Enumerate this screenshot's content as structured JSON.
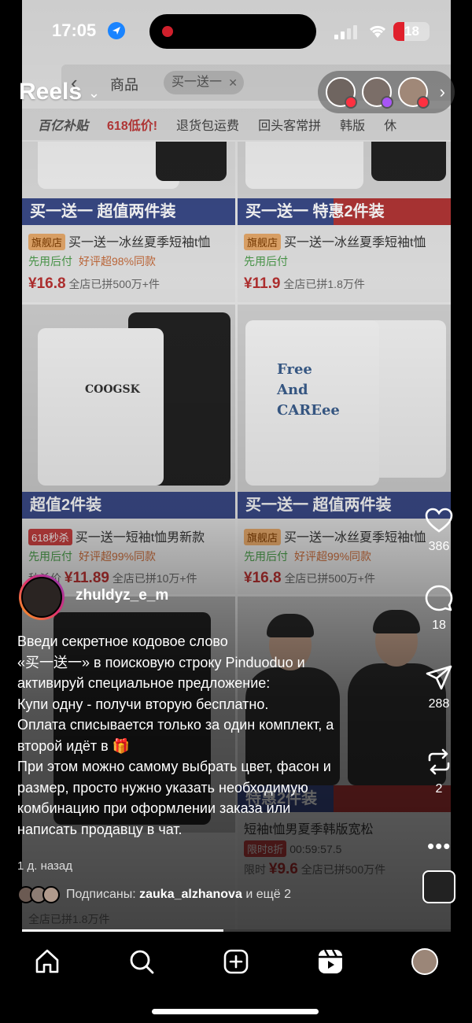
{
  "status_bar": {
    "time": "17:05",
    "battery": "18"
  },
  "header": {
    "title": "Reels",
    "friends_count_avatars": 3
  },
  "background_app": {
    "search_category": "商品",
    "search_query": "买一送一",
    "filters": [
      "百亿补贴",
      "618低价!",
      "退货包运费",
      "回头客常拼",
      "韩版",
      "休"
    ],
    "products": [
      {
        "banner": "买一送一  超值两件装",
        "tag": "旗舰店",
        "title": "买一送一冰丝夏季短袖t恤",
        "meta_left": "先用后付",
        "meta_right": "好评超98%同款",
        "price": "¥16.8",
        "sold": "全店已拼500万+件"
      },
      {
        "banner": "买一送一  特惠2件装",
        "tag": "旗舰店",
        "title": "买一送一冰丝夏季短袖t恤",
        "meta_left": "先用后付",
        "meta_right": "",
        "price": "¥11.9",
        "sold": "全店已拼1.8万件"
      },
      {
        "banner": "超值2件装",
        "tag": "618秒杀",
        "title": "买一送一短袖t恤男新款",
        "meta_left": "先用后付",
        "meta_right": "好评超99%同款",
        "price": "¥11.89",
        "sold": "全店已拼10万+件",
        "price_label": "秒杀价"
      },
      {
        "banner": "买一送一  超值两件装",
        "tag": "旗舰店",
        "title": "买一送一冰丝夏季短袖t恤",
        "meta_left": "先用后付",
        "meta_right": "好评超99%同款",
        "price": "¥16.8",
        "sold": "全店已拼500万+件"
      }
    ],
    "print_text_1": "COOGSK",
    "print_text_2": "Free And CAREee",
    "lower_banner": "特惠2件装",
    "lower_title": "短袖t恤男夏季韩版宽松",
    "lower_timer_label": "限时8折",
    "lower_timer": "00:59:57.5",
    "lower_price": "¥9.6",
    "lower_price_label": "限时",
    "lower_sold": "全店已拼500万件",
    "lower_sold_left": "全店已拼1.8万件"
  },
  "author": {
    "username": "zhuldyz_e_m"
  },
  "caption": [
    "Введи секретное кодовое слово",
    "«买一送一» в поисковую строку Pinduoduo и",
    "активируй специальное предложение:",
    "Купи одну - получи вторую бесплатно.",
    "Оплата списывается только за один комплект, а",
    "второй идёт в 🎁",
    "При этом можно самому выбрать цвет, фасон и",
    "размер, просто нужно указать необходимую",
    "комбинацию при оформлении заказа или",
    "написать продавцу в чат."
  ],
  "time_ago": "1 д. назад",
  "followed_by": {
    "prefix": "Подписаны:",
    "user": "zauka_alzhanova",
    "suffix": "и ещё 2"
  },
  "actions": {
    "likes": "386",
    "comments": "18",
    "shares": "288",
    "remixes": "2"
  },
  "video_progress": 0.47,
  "colors": {
    "accent_blue": "#1a84ff",
    "like_red": "#ff3040",
    "banner_blue": "#3a4a88",
    "banner_red": "#b23636"
  },
  "icons": [
    "location-icon",
    "wifi-icon",
    "back-icon",
    "heart-icon",
    "comment-icon",
    "share-icon",
    "remix-icon",
    "more-icon",
    "home-icon",
    "search-icon",
    "create-icon",
    "reels-icon"
  ]
}
